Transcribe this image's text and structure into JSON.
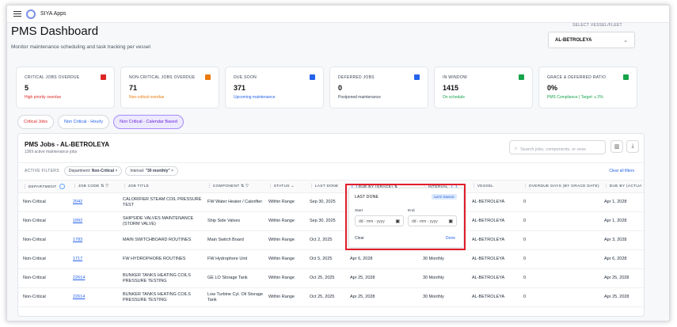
{
  "app": {
    "name": "SIYA Apps"
  },
  "header": {
    "title": "PMS Dashboard",
    "subtitle": "Monitor maintenance scheduling and task tracking per vessel",
    "vessel_label": "SELECT VESSEL/FLEET",
    "vessel_value": "AL-BETROLEYA"
  },
  "cards": [
    {
      "title": "CRITICAL JOBS OVERDUE",
      "value": "5",
      "sub": "High priority overdue",
      "color": "#dc2626"
    },
    {
      "title": "NON-CRITICAL JOBS OVERDUE",
      "value": "71",
      "sub": "Non-critical overdue",
      "color": "#ea7a0c"
    },
    {
      "title": "DUE SOON",
      "value": "371",
      "sub": "Upcoming maintenance",
      "color": "#2563eb"
    },
    {
      "title": "DEFERRED JOBS",
      "value": "0",
      "sub": "Postponed maintenance",
      "color": "#1f2937"
    },
    {
      "title": "IN WINDOW",
      "value": "1415",
      "sub": "On schedule",
      "color": "#16a34a"
    },
    {
      "title": "GRACE & DEFERRED RATIO",
      "value": "0%",
      "sub": "PMS Compliance | Target: ≤ 2%",
      "color": "#16a34a"
    }
  ],
  "tabs": [
    "Critical Jobs",
    "Non Critical - Hourly",
    "Non Critical - Calendar Based"
  ],
  "table": {
    "title": "PMS Jobs - AL-BETROLEYA",
    "count": "1369 active maintenance jobs",
    "search_placeholder": "Search jobs, components, or vess",
    "active_filters_label": "ACTIVE FILTERS",
    "chip_dept_label": "Department:",
    "chip_dept_value": "Non-Critical",
    "chip_interval_label": "Interval:",
    "chip_interval_value": "\"30 monthly\"",
    "clear_all": "Clear all filters",
    "columns": [
      "DEPARTMENT",
      "JOB CODE",
      "JOB TITLE",
      "COMPONENT",
      "STATUS",
      "LAST DONE",
      "DUE BY (GRACE)",
      "INTERVAL",
      "VESSEL",
      "OVERDUE DAYS (BY GRACE DATE)",
      "DUE BY (ACTUA"
    ],
    "rows": [
      {
        "department": "Non-Critical",
        "job_code": "2042",
        "job_title": "CALORIFIER STEAM COIL PRESSURE TEST",
        "component": "FW Water Heater / Calorifier",
        "status": "Within Range",
        "last_done": "Sep 30, 2025",
        "due_by_grace": "",
        "interval": "",
        "vessel": "AL-BETROLEYA",
        "overdue": "0",
        "due_actual": "Apr 1, 2028"
      },
      {
        "department": "Non-Critical",
        "job_code": "1892",
        "job_title": "SHIPSIDE VALVES MAINTENANCE (STORM VALVE)",
        "component": "Ship Side Valves",
        "status": "Within Range",
        "last_done": "Sep 30, 2025",
        "due_by_grace": "",
        "interval": "",
        "vessel": "AL-BETROLEYA",
        "overdue": "0",
        "due_actual": "Apr 1, 2028"
      },
      {
        "department": "Non-Critical",
        "job_code": "1783",
        "job_title": "MAIN SWITCHBOARD ROUTINES",
        "component": "Main Switch Board",
        "status": "Within Range",
        "last_done": "Oct 2, 2025",
        "due_by_grace": "",
        "interval": "",
        "vessel": "AL-BETROLEYA",
        "overdue": "0",
        "due_actual": "Apr 3, 2028"
      },
      {
        "department": "Non-Critical",
        "job_code": "1717",
        "job_title": "FW HYDROPHORE ROUTINES",
        "component": "FW Hydrophore Unit",
        "status": "Within Range",
        "last_done": "Oct 5, 2025",
        "due_by_grace": "Apr 6, 2028",
        "interval": "30 Monthly",
        "vessel": "AL-BETROLEYA",
        "overdue": "0",
        "due_actual": "Apr 6, 2028"
      },
      {
        "department": "Non-Critical",
        "job_code": "22614",
        "job_title": "BUNKER TANKS HEATING COILS PRESSURE TESTING",
        "component": "GE LO Storage Tank",
        "status": "Within Range",
        "last_done": "Oct 25, 2025",
        "due_by_grace": "Apr 25, 2028",
        "interval": "30 Monthly",
        "vessel": "AL-BETROLEYA",
        "overdue": "0",
        "due_actual": "Apr 25, 2028"
      },
      {
        "department": "Non-Critical",
        "job_code": "22614",
        "job_title": "BUNKER TANKS HEATING COILS PRESSURE TESTING",
        "component": "Low Turbine Cyl. Oil Storage Tank",
        "status": "Within Range",
        "last_done": "Oct 25, 2025",
        "due_by_grace": "Apr 25, 2028",
        "interval": "30 Monthly",
        "vessel": "AL-BETROLEYA",
        "overdue": "0",
        "due_actual": "Apr 25, 2028"
      }
    ]
  },
  "popover": {
    "title": "LAST DONE",
    "badge": "DATE RANGE",
    "start_label": "Start",
    "end_label": "End",
    "start_placeholder": "dd - mm - yyyy",
    "end_placeholder": "dd - mm - yyyy",
    "clear": "Clear",
    "done": "Done"
  }
}
